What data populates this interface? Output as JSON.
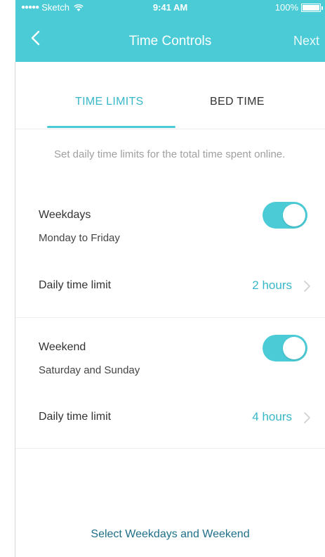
{
  "status_bar": {
    "carrier": "Sketch",
    "time": "9:41 AM",
    "battery": "100%"
  },
  "nav": {
    "title": "Time Controls",
    "next_label": "Next"
  },
  "tabs": [
    {
      "label": "TIME LIMITS",
      "active": true
    },
    {
      "label": "BED TIME",
      "active": false
    }
  ],
  "description": "Set daily time limits for the total time spent online.",
  "weekdays": {
    "label": "Weekdays",
    "sub": "Monday to Friday",
    "enabled": true,
    "limit_label": "Daily time limit",
    "limit_value": "2 hours"
  },
  "weekend": {
    "label": "Weekend",
    "sub": "Saturday and Sunday",
    "enabled": true,
    "limit_label": "Daily time limit",
    "limit_value": "4 hours"
  },
  "bottom_link": "Select Weekdays and Weekend",
  "colors": {
    "accent": "#4acbd6",
    "accent_text": "#38b7c8",
    "link": "#1f6f88"
  },
  "icons": {
    "back": "chevron-left-icon",
    "row_chevron": "chevron-right-icon",
    "wifi": "wifi-icon",
    "battery": "battery-icon"
  }
}
